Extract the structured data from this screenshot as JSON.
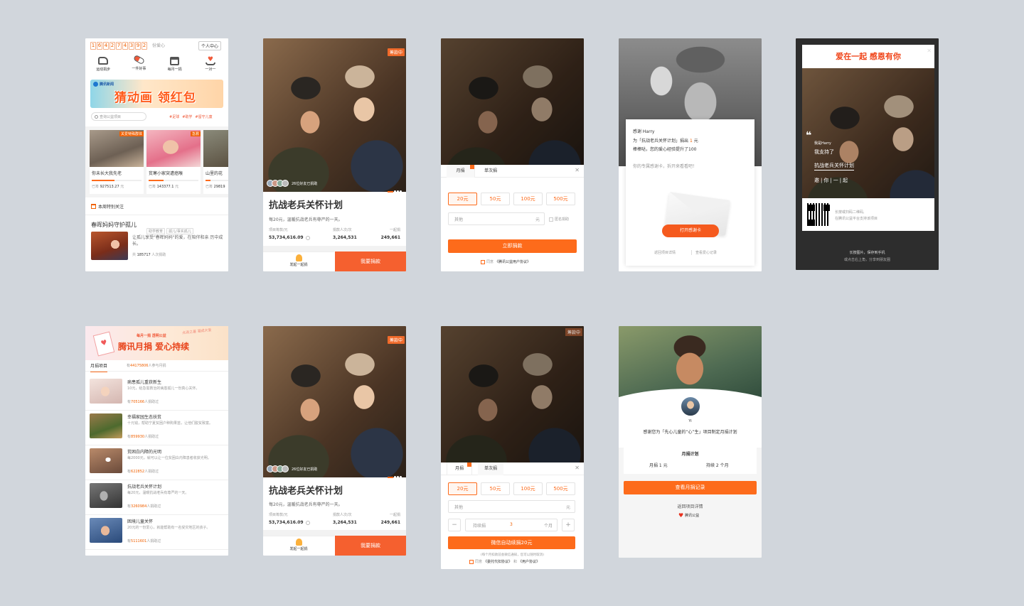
{
  "s1": {
    "counter_digits": [
      "1",
      "6",
      "4",
      "2",
      "7",
      "4",
      "3",
      "9",
      "2"
    ],
    "counter_suffix": "份爱心",
    "personal_center": "个人中心",
    "nav": [
      "运动捐步",
      "一件好事",
      "每月一捐",
      "一对一"
    ],
    "banner_source": "腾讯新闻",
    "banner_title": "猜动画 领红包",
    "search_placeholder": "查询公益项目",
    "hot_tags": [
      "#足球",
      "#助学",
      "#留守儿童"
    ],
    "cards": [
      {
        "badge": "关爱特殊群体",
        "title": "你未长大我先老",
        "raised_label": "已筹",
        "raised": "927513.27",
        "unit": "元",
        "progress": 0.45
      },
      {
        "badge": "急救",
        "title": "贫寒小家突遭癌喉",
        "raised_label": "已筹",
        "raised": "143377.1",
        "unit": "元",
        "progress": 0.3
      },
      {
        "badge": "",
        "title": "山里的花",
        "raised_label": "已筹",
        "raised": "29819",
        "unit": "",
        "progress": 0.2
      }
    ],
    "weekly_title": "本周特别关注",
    "feature_title": "春晖妈妈守护孤儿",
    "feature_tags": [
      "助学教育",
      "孤儿/事实孤儿"
    ],
    "feature_desc": "让孤儿享受\"春晖妈妈\"的爱，在陪伴和亲 历中成长。",
    "feature_count_pre": "共",
    "feature_count": "185717",
    "feature_count_post": "人次捐助"
  },
  "detail": {
    "badge": "筹款中",
    "friends": "26位好友已捐助",
    "title": "抗战老兵关怀计划",
    "desc": "每20元，温暖抗战老兵有尊严的一天。",
    "stat_labels": [
      "项目筹款/元",
      "捐款人次/次",
      "一起捐"
    ],
    "stat_values": [
      "53,734,616.09",
      "3,264,531",
      "249,661"
    ],
    "launch_label": "发起一起捐",
    "donate_label": "我要捐款"
  },
  "s3": {
    "tab_monthly": "月捐",
    "tab_single": "单次捐",
    "amounts": [
      "20元",
      "50元",
      "100元",
      "500元"
    ],
    "other_placeholder": "其他",
    "yuan": "元",
    "anonymous": "匿名捐助",
    "donate_now": "立即捐款",
    "agree_pre": "同意",
    "agree_link": "《腾讯公益用户协议》"
  },
  "s4": {
    "thanks_to": "感谢 Harry",
    "line1_pre": "为「抗战老兵关怀计划」捐出",
    "line1_amt": "1",
    "line1_post": "元",
    "line2": "棒棒哒，您的爱心经验提升了100",
    "line3": "你的专属感谢卡，拆开来看看吧！",
    "open_card": "打开感谢卡",
    "link_detail": "返回项目详情",
    "link_record": "查看爱心记录"
  },
  "s5": {
    "header": "爱在一起 感恩有你",
    "quote_user": "我是Harry",
    "quote_support": "我支持了",
    "quote_project": "抗战老兵关怀计划",
    "quote_invite": "邀|你|一|起",
    "qr_line1": "长按或扫码二维码,",
    "qr_line2": "在腾讯公益平台支持该项目",
    "footer1": "长按图片，保存到手机",
    "footer2": "或点击右上角，分享到朋友圈"
  },
  "s6": {
    "banner_small": "每月一捐  透明公益",
    "banner_title": "腾讯月捐 爱心持续",
    "banner_script": "点滴之善 凝成大爱",
    "tab": "月捐项目",
    "count_pre": "有",
    "count": "44175806",
    "count_post": "人参与月捐",
    "items": [
      {
        "title": "病患孤儿重获新生",
        "desc": "10元，给急需救治的病患孤儿一份真心关怀。",
        "count": "705166",
        "post": "人捐助过"
      },
      {
        "title": "幸福家园生态扶贫",
        "desc": "十元钱，帮助宁夏贫困户种购果苗，让他们脱贫致富。",
        "count": "859930",
        "post": "人捐助过"
      },
      {
        "title": "贫困白内障的光明",
        "desc": "每2000元，就可以让一位贫困白内障患者收获光明。",
        "count": "622852",
        "post": "人捐助过"
      },
      {
        "title": "抗战老兵关怀计划",
        "desc": "每20元，温暖抗战老兵有尊严的一天。",
        "count": "3260984",
        "post": "人捐助过"
      },
      {
        "title": "困境儿童关怀",
        "desc": "20元的一份爱心，就能帮助有一名受灾地区的孩子。",
        "count": "5111601",
        "post": "人捐助过"
      }
    ]
  },
  "s8": {
    "badge": "筹款中",
    "tab_monthly": "月捐",
    "tab_single": "单次捐",
    "amounts": [
      "20元",
      "50元",
      "100元",
      "500元"
    ],
    "other_placeholder": "其他",
    "yuan": "元",
    "duration_label": "持续捐",
    "duration_value": "3",
    "duration_unit": "个月",
    "minus": "−",
    "plus": "+",
    "submit": "微信自动续捐20元",
    "note": "(每个月扣款前会微信通知，您可以随时取消)",
    "agree_pre": "同意",
    "agree_link1": "《委托代扣协议》",
    "agree_and": "和",
    "agree_link2": "《用户协议》"
  },
  "s9": {
    "user": "Yi",
    "thanks": "感谢您为「先心儿童的“心”生」项目制定月捐计划",
    "plan_title": "月捐计划",
    "plan_amount": "月捐 1 元",
    "plan_duration": "持续 2 个月",
    "view_record": "查看月捐记录",
    "back": "返回项目详情",
    "brand": "腾讯公益"
  }
}
